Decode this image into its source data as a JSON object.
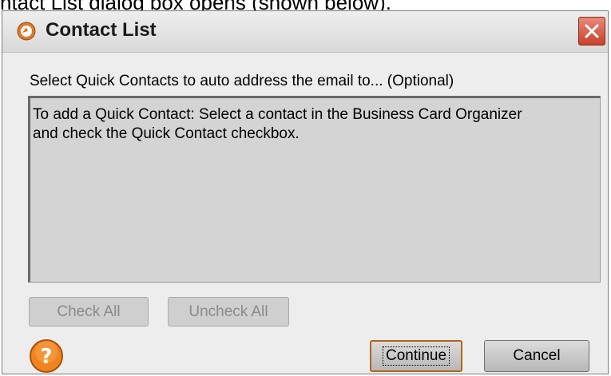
{
  "background_caption": "ntact List dialog box opens (shown below).",
  "dialog": {
    "title": "Contact List",
    "instruction": "Select Quick Contacts to auto address the email to... (Optional)",
    "list_message_line1": "To add a Quick Contact:  Select a contact in the Business Card Organizer",
    "list_message_line2": "and check the Quick Contact checkbox.",
    "buttons": {
      "check_all": "Check All",
      "uncheck_all": "Uncheck All",
      "continue": "Continue",
      "cancel": "Cancel"
    },
    "icons": {
      "app": "app-logo-icon",
      "close": "close-icon",
      "help": "help-icon"
    },
    "colors": {
      "close_button": "#c8402c",
      "help_button": "#f0841e",
      "default_button_border": "#b5651d"
    }
  }
}
